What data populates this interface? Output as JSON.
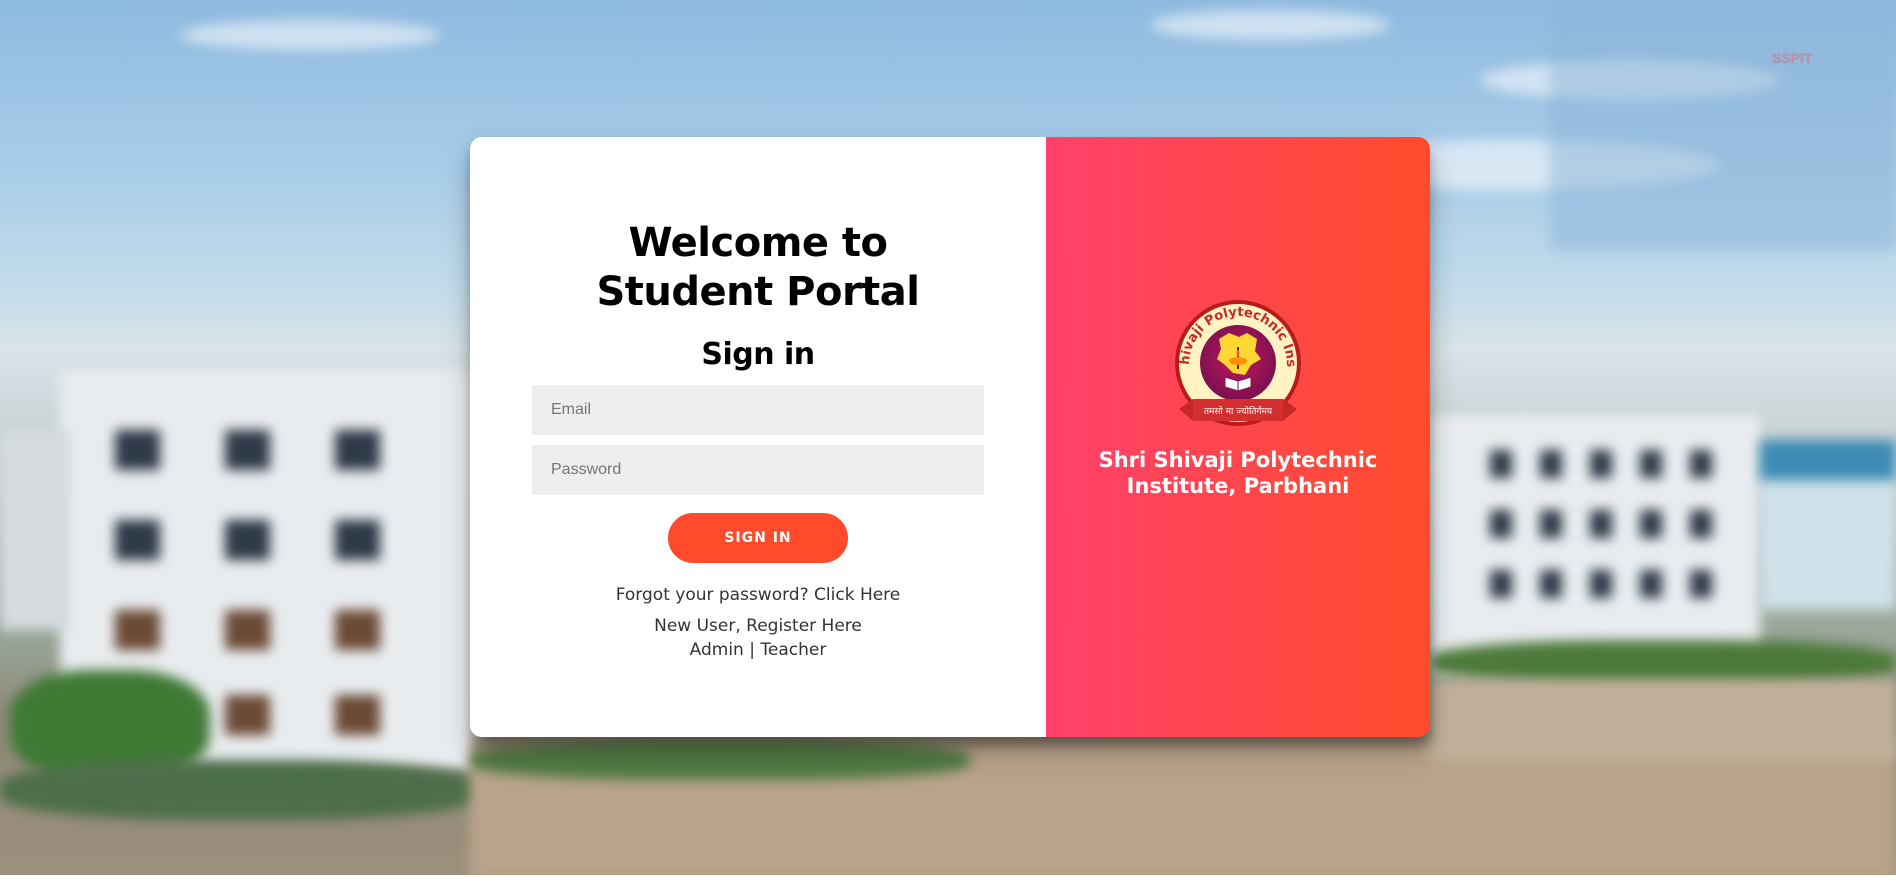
{
  "watermark": "SSPIT",
  "signin": {
    "title_line1": "Welcome to",
    "title_line2": "Student Portal",
    "heading": "Sign in",
    "email_placeholder": "Email",
    "password_placeholder": "Password",
    "button_label": "SIGN IN",
    "forgot_text": "Forgot your password?",
    "forgot_link": "Click Here",
    "new_user_text": "New User,",
    "register_link": "Register Here",
    "admin_link": "Admin",
    "separator": "|",
    "teacher_link": "Teacher"
  },
  "brand": {
    "logo_arc_text": "Shri Shivaji Polytechnic Institute",
    "logo_motto": "तमसो मा ज्योतिर्गमय",
    "name_line1": "Shri Shivaji Polytechnic",
    "name_line2": "Institute, Parbhani"
  },
  "colors": {
    "gradient_start": "#ff416c",
    "gradient_end": "#ff4b2b",
    "button": "#ff4b2b",
    "input_bg": "#eeeeee"
  }
}
